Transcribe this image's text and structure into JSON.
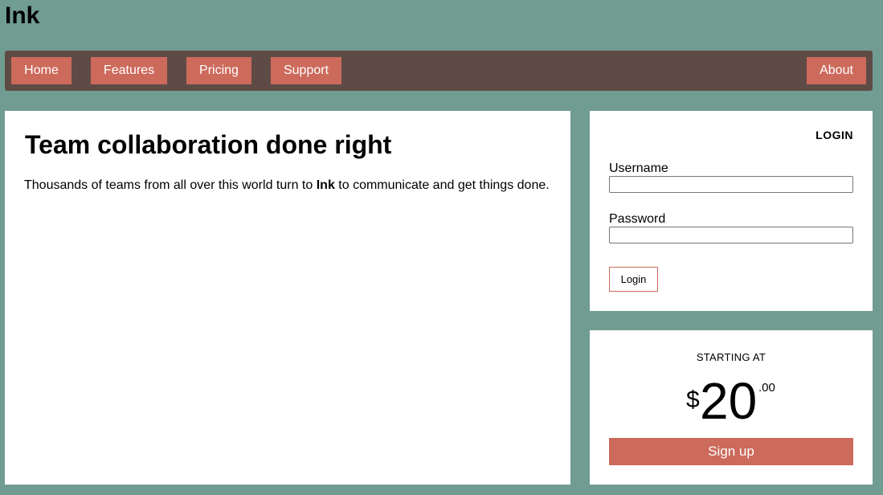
{
  "site": {
    "title": "Ink"
  },
  "nav": {
    "home": "Home",
    "features": "Features",
    "pricing": "Pricing",
    "support": "Support",
    "about": "About"
  },
  "main": {
    "heading": "Team collaboration done right",
    "text_before": "Thousands of teams from all over this world turn to ",
    "text_brand": "Ink",
    "text_after": " to communicate and get things done."
  },
  "login": {
    "heading": "LOGIN",
    "username_label": "Username",
    "username_value": "",
    "password_label": "Password",
    "password_value": "",
    "button": "Login"
  },
  "pricing": {
    "caption": "STARTING AT",
    "currency": "$",
    "amount": "20",
    "cents": ".00",
    "signup": "Sign up"
  },
  "colors": {
    "background": "#719c91",
    "navbar": "#5f4b46",
    "accent": "#cc6a5b",
    "card": "#ffffff"
  }
}
